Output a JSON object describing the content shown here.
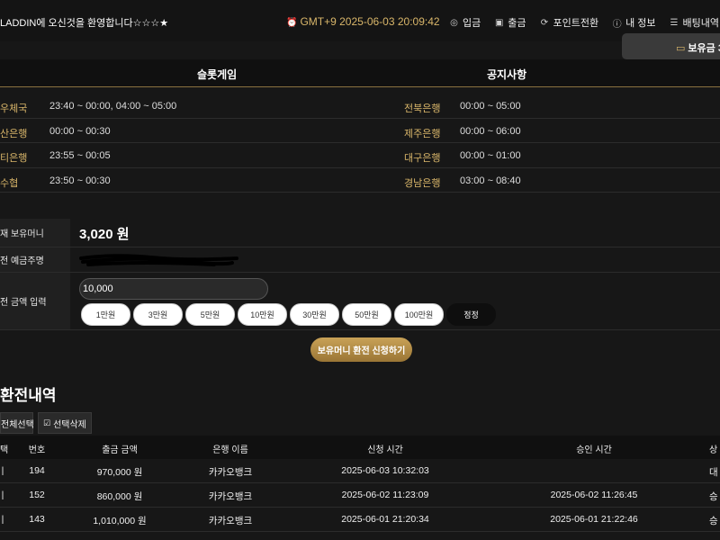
{
  "header": {
    "welcome": "LADDIN에 오신것을 환영합니다☆☆☆★",
    "clock": "GMT+9 2025-06-03 20:09:42",
    "nav": [
      {
        "icon": "deposit-icon",
        "label": "입금"
      },
      {
        "icon": "withdraw-icon",
        "label": "출금"
      },
      {
        "icon": "refresh-icon",
        "label": "포인트전환"
      },
      {
        "icon": "info-icon",
        "label": "내 정보"
      },
      {
        "icon": "list-icon",
        "label": "배팅내역"
      },
      {
        "icon": "calendar-icon",
        "label": ""
      }
    ],
    "balance_label": "보유금 3"
  },
  "tabs": [
    "슬롯게임",
    "공지사항"
  ],
  "bank_hours": [
    {
      "bank1": "우체국",
      "time1": "23:40 ~ 00:00, 04:00 ~ 05:00",
      "bank2": "전북은행",
      "time2": "00:00 ~ 05:00"
    },
    {
      "bank1": "산은행",
      "time1": "00:00 ~ 00:30",
      "bank2": "제주은행",
      "time2": "00:00 ~ 06:00"
    },
    {
      "bank1": "티은행",
      "time1": "23:55 ~ 00:05",
      "bank2": "대구은행",
      "time2": "00:00 ~ 01:00"
    },
    {
      "bank1": "수협",
      "time1": "23:50 ~ 00:30",
      "bank2": "경남은행",
      "time2": "03:00 ~ 08:40"
    }
  ],
  "form": {
    "current_money_label": "재 보유머니",
    "current_money": "3,020 원",
    "depositor_label": "전 예금주명",
    "amount_label": "전 금액 입력",
    "amount_value": "10,000",
    "chips": [
      "1만원",
      "3만원",
      "5만원",
      "10만원",
      "30만원",
      "50만원",
      "100만원"
    ],
    "reset_label": "정정",
    "apply_label": "보유머니 환전 신청하기"
  },
  "history": {
    "title": "환전내역",
    "select_all": "전체선택",
    "delete_selected": "선택삭제",
    "columns": [
      "택",
      "번호",
      "출금 금액",
      "은행 이름",
      "신청 시간",
      "승인 시간",
      "상"
    ],
    "rows": [
      {
        "no": "194",
        "amount": "970,000 원",
        "bank": "카카오뱅크",
        "requested": "2025-06-03 10:32:03",
        "approved": "",
        "status": "대"
      },
      {
        "no": "152",
        "amount": "860,000 원",
        "bank": "카카오뱅크",
        "requested": "2025-06-02 11:23:09",
        "approved": "2025-06-02 11:26:45",
        "status": "승"
      },
      {
        "no": "143",
        "amount": "1,010,000 원",
        "bank": "카카오뱅크",
        "requested": "2025-06-01 21:20:34",
        "approved": "2025-06-01 21:22:46",
        "status": "승"
      }
    ]
  },
  "colors": {
    "accent": "#d9b66a",
    "background": "#171717"
  }
}
